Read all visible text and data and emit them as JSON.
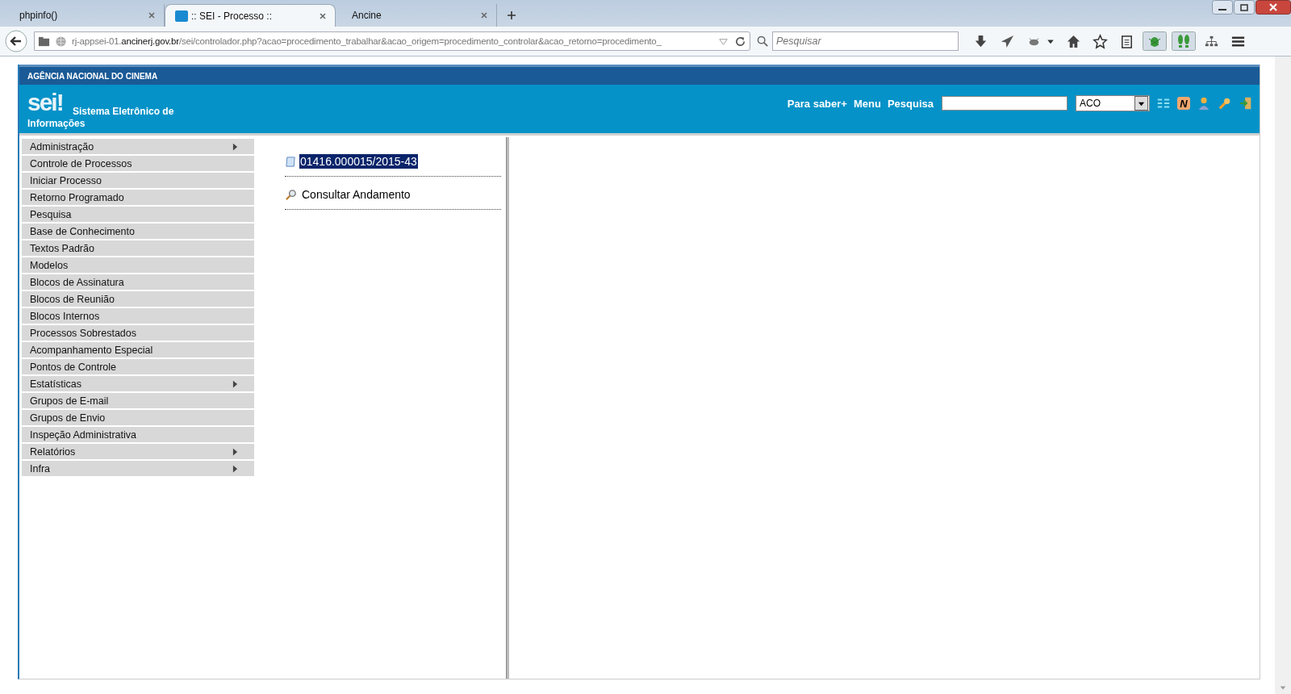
{
  "browser": {
    "tabs": [
      {
        "title": "phpinfo()",
        "selected": false,
        "favicon": false
      },
      {
        "title": ":: SEI - Processo ::",
        "selected": true,
        "favicon": true
      },
      {
        "title": "Ancine",
        "selected": false,
        "favicon": false
      }
    ],
    "url": {
      "prefix": "rj-appsei-01.",
      "domain": "ancinerj.gov.br",
      "path": "/sei/controlador.php?acao=procedimento_trabalhar&acao_origem=procedimento_controlar&acao_retorno=procedimento_"
    },
    "search": {
      "placeholder": "Pesquisar"
    }
  },
  "header": {
    "agency": "AGÊNCIA NACIONAL DO CINEMA",
    "logo": "sei!",
    "system_name": "Sistema Eletrônico de Informações",
    "links": [
      "Para saber+",
      "Menu",
      "Pesquisa"
    ],
    "unit": "ACO",
    "badge": "N"
  },
  "menu": [
    {
      "label": "Administração",
      "submenu": true
    },
    {
      "label": "Controle de Processos",
      "submenu": false
    },
    {
      "label": "Iniciar Processo",
      "submenu": false
    },
    {
      "label": "Retorno Programado",
      "submenu": false
    },
    {
      "label": "Pesquisa",
      "submenu": false
    },
    {
      "label": "Base de Conhecimento",
      "submenu": false
    },
    {
      "label": "Textos Padrão",
      "submenu": false
    },
    {
      "label": "Modelos",
      "submenu": false
    },
    {
      "label": "Blocos de Assinatura",
      "submenu": false
    },
    {
      "label": "Blocos de Reunião",
      "submenu": false
    },
    {
      "label": "Blocos Internos",
      "submenu": false
    },
    {
      "label": "Processos Sobrestados",
      "submenu": false
    },
    {
      "label": "Acompanhamento Especial",
      "submenu": false
    },
    {
      "label": "Pontos de Controle",
      "submenu": false
    },
    {
      "label": "Estatísticas",
      "submenu": true
    },
    {
      "label": "Grupos de E-mail",
      "submenu": false
    },
    {
      "label": "Grupos de Envio",
      "submenu": false
    },
    {
      "label": "Inspeção Administrativa",
      "submenu": false
    },
    {
      "label": "Relatórios",
      "submenu": true
    },
    {
      "label": "Infra",
      "submenu": true
    }
  ],
  "tree": {
    "process": {
      "number": "01416.000015/2015-43",
      "selected": true
    },
    "action": "Consultar Andamento"
  }
}
